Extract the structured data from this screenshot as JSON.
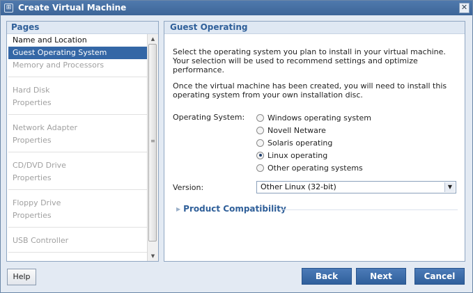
{
  "window": {
    "title": "Create Virtual Machine",
    "close_glyph": "✕"
  },
  "pages_panel": {
    "header": "Pages",
    "items": [
      {
        "label": "Name and Location",
        "state": "enabled"
      },
      {
        "label": "Guest Operating System",
        "state": "selected"
      },
      {
        "label": "Memory and Processors",
        "state": "disabled"
      },
      {
        "label": "Hard Disk",
        "state": "disabled"
      },
      {
        "label": "Properties",
        "state": "disabled"
      },
      {
        "label": "Network Adapter",
        "state": "disabled"
      },
      {
        "label": "Properties",
        "state": "disabled"
      },
      {
        "label": "CD/DVD Drive",
        "state": "disabled"
      },
      {
        "label": "Properties",
        "state": "disabled"
      },
      {
        "label": "Floppy Drive",
        "state": "disabled"
      },
      {
        "label": "Properties",
        "state": "disabled"
      },
      {
        "label": "USB Controller",
        "state": "disabled"
      }
    ]
  },
  "content": {
    "header": "Guest Operating",
    "intro_text": "Select the operating system you plan to install in your virtual machine. Your selection will be used to recommend settings and optimize performance.",
    "install_text": "Once the virtual machine has been created, you will need to install this operating system from your own installation disc.",
    "os_label": "Operating System:",
    "os_options": [
      {
        "label": "Windows operating system",
        "checked": false
      },
      {
        "label": "Novell Netware",
        "checked": false
      },
      {
        "label": "Solaris operating",
        "checked": false
      },
      {
        "label": "Linux operating",
        "checked": true
      },
      {
        "label": "Other operating systems",
        "checked": false
      }
    ],
    "version_label": "Version:",
    "version_value": "Other Linux (32-bit)",
    "product_compat": "Product Compatibility"
  },
  "buttons": {
    "help": "Help",
    "back": "Back",
    "next": "Next",
    "cancel": "Cancel"
  },
  "colors": {
    "accent": "#3467a6",
    "title_bar": "#4a74a8",
    "header_text": "#2f5f99"
  }
}
